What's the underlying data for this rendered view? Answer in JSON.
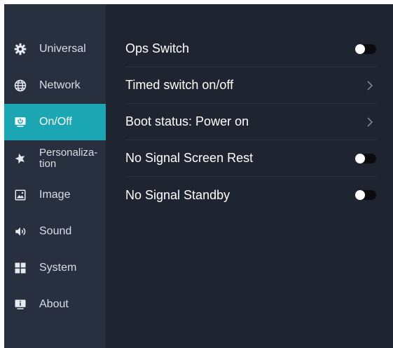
{
  "sidebar": {
    "items": [
      {
        "label": "Universal",
        "icon": "gear-icon",
        "active": false
      },
      {
        "label": "Network",
        "icon": "globe-icon",
        "active": false
      },
      {
        "label": "On/Off",
        "icon": "power-monitor-icon",
        "active": true
      },
      {
        "label": "Personaliza-tion",
        "icon": "star-icon",
        "active": false
      },
      {
        "label": "Image",
        "icon": "image-icon",
        "active": false
      },
      {
        "label": "Sound",
        "icon": "speaker-icon",
        "active": false
      },
      {
        "label": "System",
        "icon": "grid-icon",
        "active": false
      },
      {
        "label": "About",
        "icon": "info-monitor-icon",
        "active": false
      }
    ]
  },
  "settings": {
    "rows": [
      {
        "label": "Ops Switch",
        "control": "toggle",
        "on": false
      },
      {
        "label": "Timed switch on/off",
        "control": "chevron"
      },
      {
        "label": "Boot status:  Power on",
        "control": "chevron"
      },
      {
        "label": "No Signal Screen Rest",
        "control": "toggle",
        "on": false
      },
      {
        "label": "No Signal Standby",
        "control": "toggle",
        "on": false
      }
    ]
  },
  "colors": {
    "background": "#1f2530",
    "sidebar": "#283040",
    "active": "#1aa6b3",
    "text": "#ffffff",
    "muted_text": "#d9dde4"
  }
}
